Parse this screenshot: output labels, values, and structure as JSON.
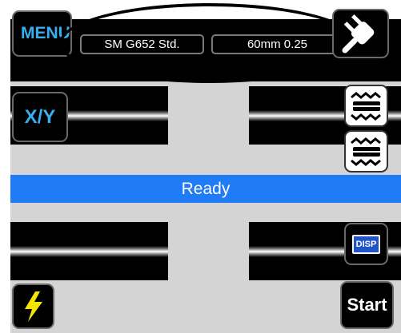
{
  "header": {
    "menu_label": "MENU",
    "fiber_setting": "SM G652 Std.",
    "heater_setting": "60mm 0.25"
  },
  "controls": {
    "xy_label": "X/Y",
    "disp_label": "DISP",
    "start_label": "Start"
  },
  "status": {
    "text": "Ready",
    "color": "#1f7bf6"
  },
  "icons": {
    "power": "plug-icon",
    "motor": "motor-icon",
    "arc": "lightning-icon"
  },
  "colors": {
    "accent_text": "#36aef0",
    "background": "#d4d4d4",
    "button_bg": "#000000",
    "arc_icon": "#f5e600"
  }
}
